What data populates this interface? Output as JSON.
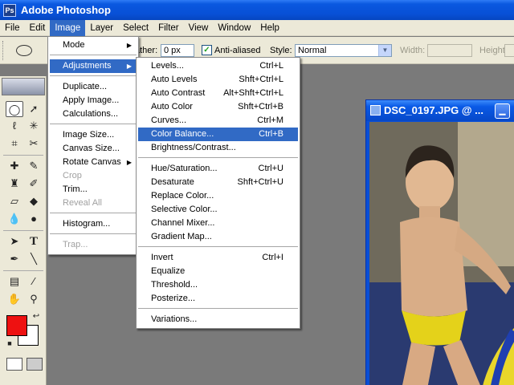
{
  "window": {
    "title": "Adobe Photoshop",
    "icon": "photoshop-app-icon"
  },
  "menubar": [
    "File",
    "Edit",
    "Image",
    "Layer",
    "Select",
    "Filter",
    "View",
    "Window",
    "Help"
  ],
  "options": {
    "feather_label": "ather:",
    "feather_value": "0 px",
    "antialias_label": "Anti-aliased",
    "antialias_checked": true,
    "style_label": "Style:",
    "style_value": "Normal",
    "width_label": "Width:",
    "height_label": "Height:"
  },
  "tools": [
    "marquee-tool",
    "move-tool",
    "lasso-tool",
    "magic-wand-tool",
    "crop-tool",
    "slice-tool",
    "healing-brush-tool",
    "brush-tool",
    "clone-stamp-tool",
    "history-brush-tool",
    "eraser-tool",
    "paint-bucket-tool",
    "blur-tool",
    "dodge-tool",
    "path-selection-tool",
    "type-tool",
    "pen-tool",
    "line-tool",
    "notes-tool",
    "eyedropper-tool",
    "hand-tool",
    "zoom-tool"
  ],
  "colors": {
    "foreground": "#ee1111",
    "background": "#ffffff",
    "menu_highlight": "#316ac5",
    "titlebar": "#0a58e0"
  },
  "image_menu": {
    "items": [
      {
        "label": "Mode",
        "submenu": true
      },
      {
        "label": "Adjustments",
        "submenu": true,
        "highlighted": true
      },
      {
        "label": "Duplicate..."
      },
      {
        "label": "Apply Image..."
      },
      {
        "label": "Calculations..."
      },
      {
        "label": "Image Size..."
      },
      {
        "label": "Canvas Size..."
      },
      {
        "label": "Rotate Canvas",
        "submenu": true
      },
      {
        "label": "Crop",
        "disabled": true
      },
      {
        "label": "Trim..."
      },
      {
        "label": "Reveal All",
        "disabled": true
      },
      {
        "label": "Histogram..."
      },
      {
        "label": "Trap...",
        "disabled": true
      }
    ]
  },
  "adjustments_menu": {
    "items": [
      {
        "label": "Levels...",
        "shortcut": "Ctrl+L"
      },
      {
        "label": "Auto Levels",
        "shortcut": "Shft+Ctrl+L"
      },
      {
        "label": "Auto Contrast",
        "shortcut": "Alt+Shft+Ctrl+L"
      },
      {
        "label": "Auto Color",
        "shortcut": "Shft+Ctrl+B"
      },
      {
        "label": "Curves...",
        "shortcut": "Ctrl+M"
      },
      {
        "label": "Color Balance...",
        "shortcut": "Ctrl+B",
        "highlighted": true
      },
      {
        "label": "Brightness/Contrast...",
        "shortcut": ""
      },
      {
        "label": "Hue/Saturation...",
        "shortcut": "Ctrl+U"
      },
      {
        "label": "Desaturate",
        "shortcut": "Shft+Ctrl+U"
      },
      {
        "label": "Replace Color...",
        "shortcut": ""
      },
      {
        "label": "Selective Color...",
        "shortcut": ""
      },
      {
        "label": "Channel Mixer...",
        "shortcut": ""
      },
      {
        "label": "Gradient Map...",
        "shortcut": ""
      },
      {
        "label": "Invert",
        "shortcut": "Ctrl+I"
      },
      {
        "label": "Equalize",
        "shortcut": ""
      },
      {
        "label": "Threshold...",
        "shortcut": ""
      },
      {
        "label": "Posterize...",
        "shortcut": ""
      },
      {
        "label": "Variations...",
        "shortcut": ""
      }
    ]
  },
  "document": {
    "title": "DSC_0197.JPG @ ..."
  }
}
